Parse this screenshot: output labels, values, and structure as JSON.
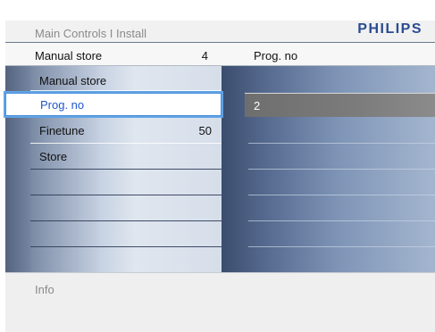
{
  "header": {
    "breadcrumb": "Main Controls I Install",
    "brand": "PHILIPS"
  },
  "status": {
    "left_label": "Manual store",
    "left_value": "4",
    "right_label": "Prog. no"
  },
  "menu": {
    "items": [
      {
        "label": "Manual store",
        "value": ""
      },
      {
        "label": "Prog. no",
        "value": "",
        "selected": true
      },
      {
        "label": "Finetune",
        "value": "50"
      },
      {
        "label": "Store",
        "value": ""
      }
    ]
  },
  "submenu": {
    "selected_value": "2"
  },
  "info": {
    "label": "Info"
  },
  "colors": {
    "brand": "#2a4b91",
    "selection_border": "#4a90d9",
    "selected_text": "#1f57c8"
  }
}
